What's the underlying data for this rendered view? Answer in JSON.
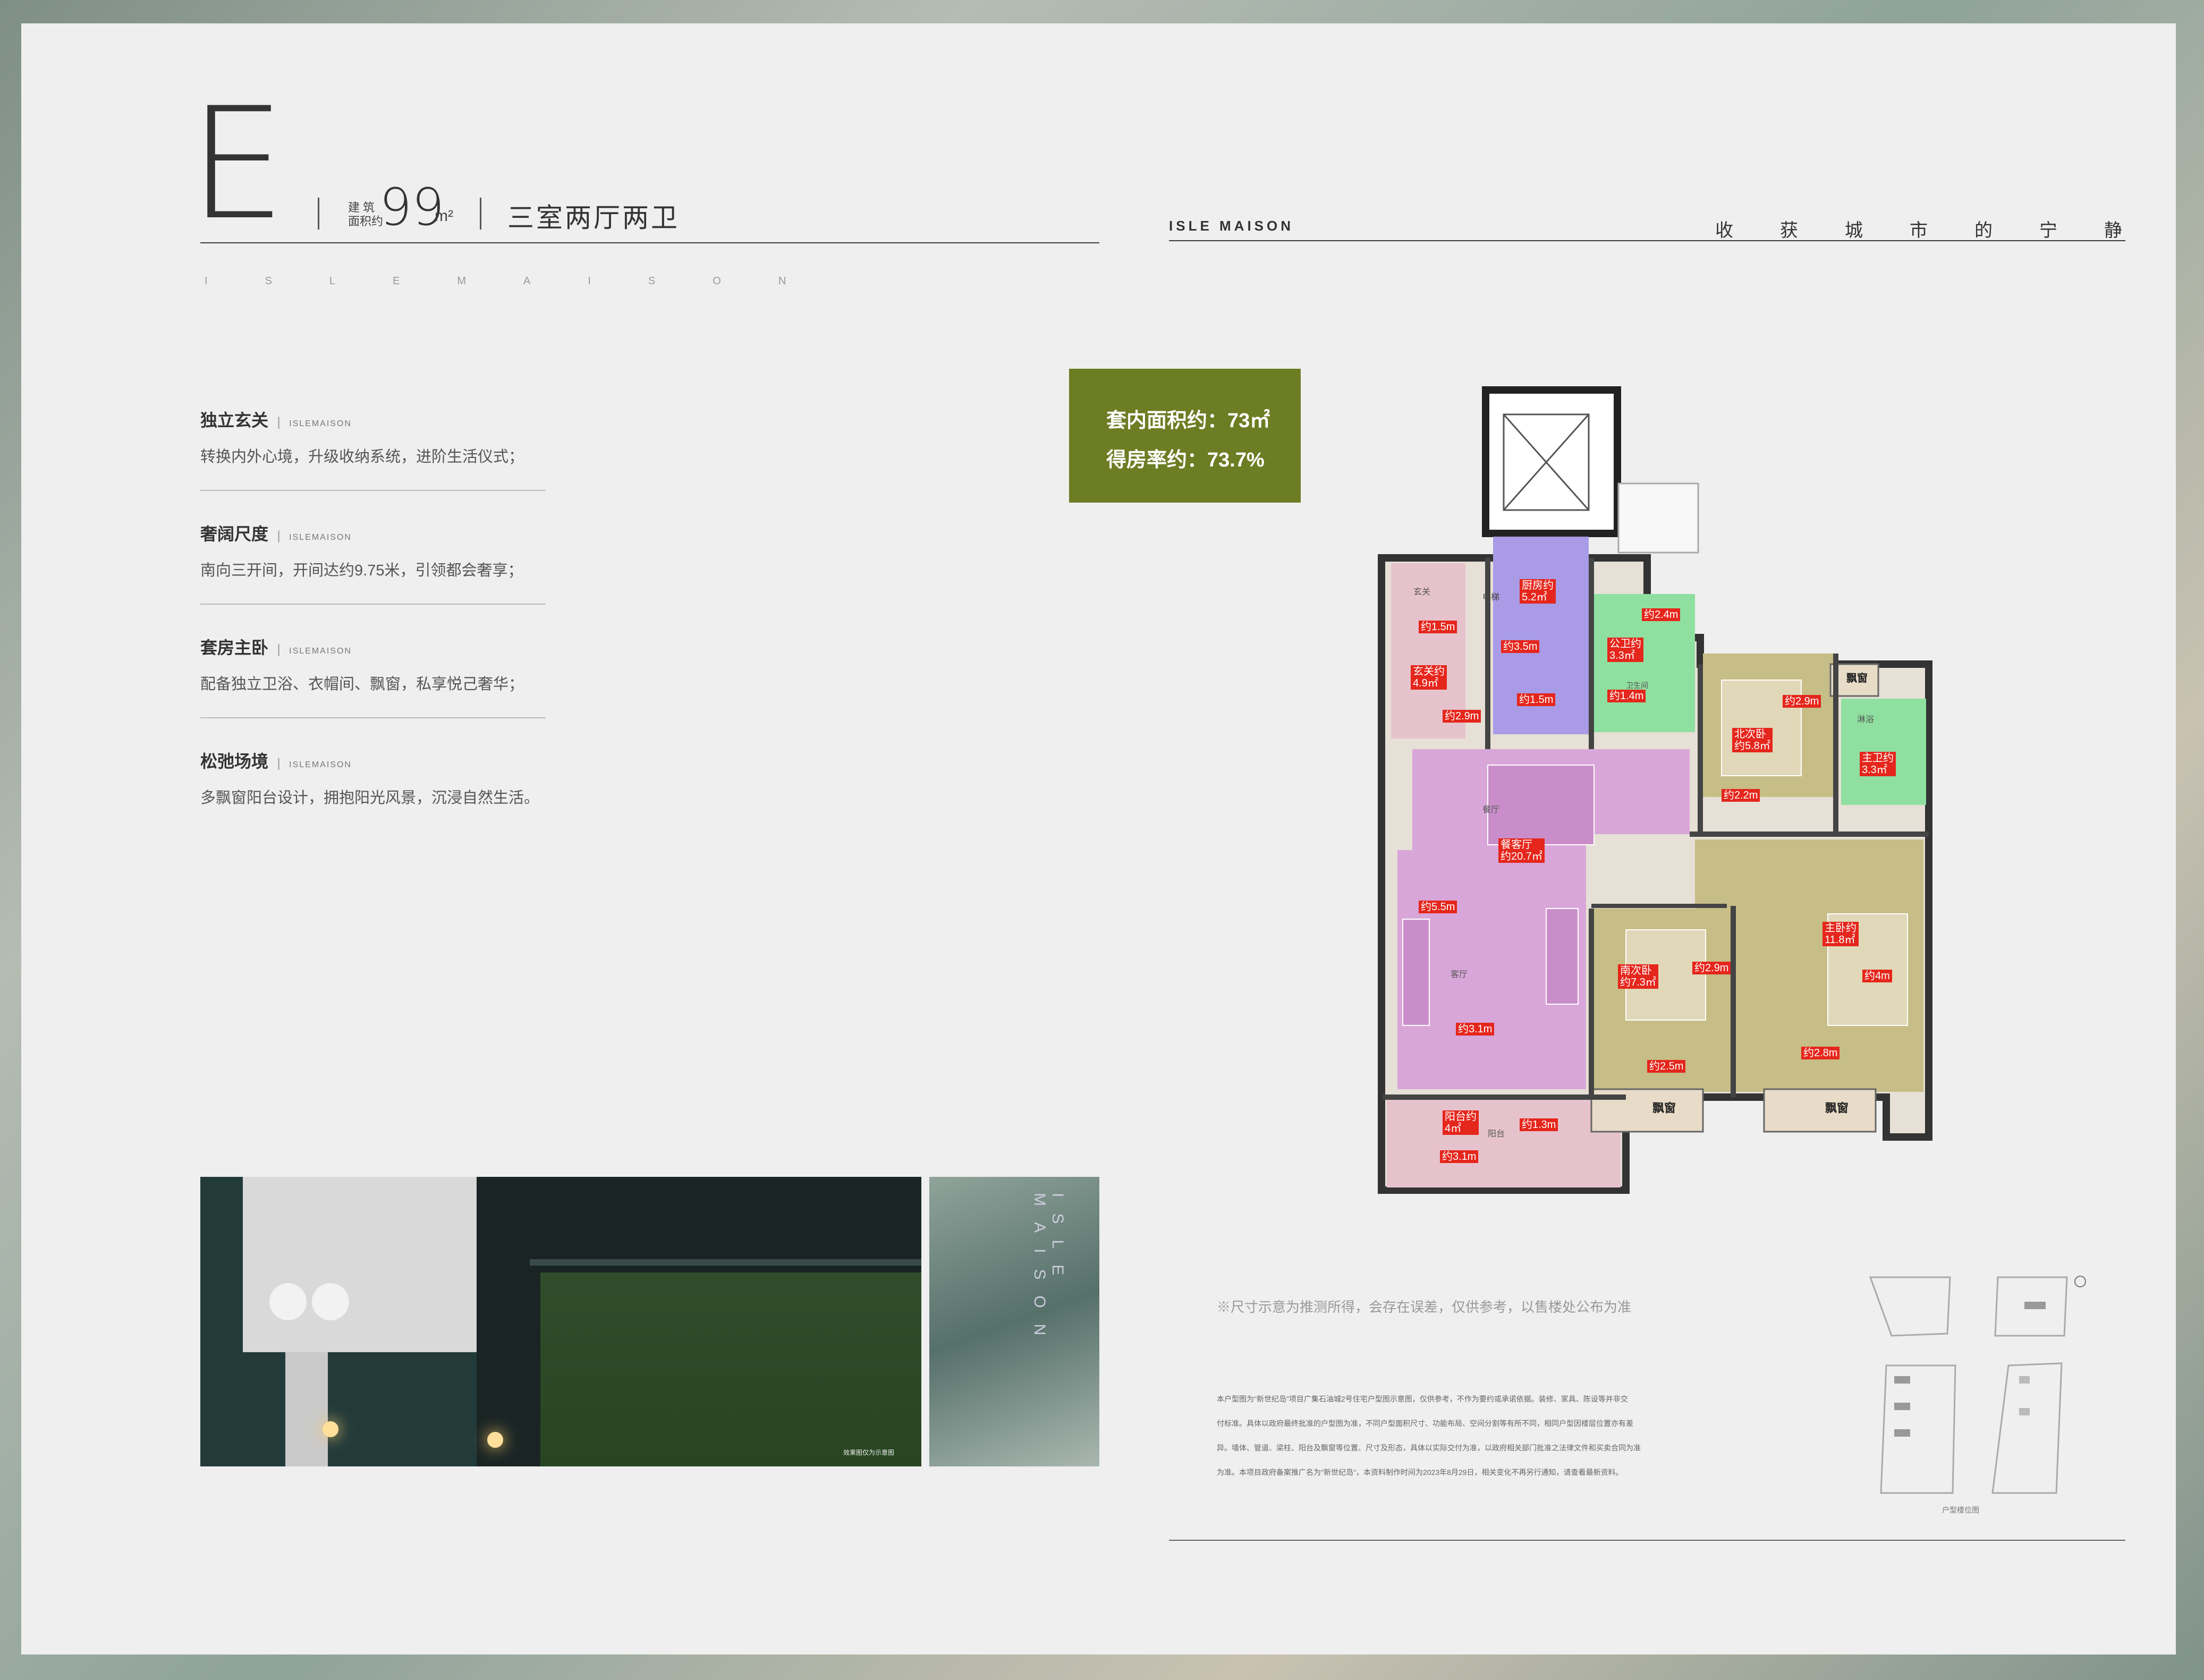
{
  "header": {
    "type_letter": "E",
    "area_label_line1": "建 筑",
    "area_label_line2": "面积约",
    "area_value": "99",
    "area_unit": "m²",
    "layout_title": "三室两厅两卫",
    "spaced_brand": "ISLEMAISON",
    "brand": "ISLE MAISON",
    "slogan": "收获城市的宁静"
  },
  "features": [
    {
      "title": "独立玄关",
      "sub": "ISLEMAISON",
      "desc": "转换内外心境，升级收纳系统，进阶生活仪式；"
    },
    {
      "title": "奢阔尺度",
      "sub": "ISLEMAISON",
      "desc": "南向三开间，开间达约9.75米，引领都会奢享；"
    },
    {
      "title": "套房主卧",
      "sub": "ISLEMAISON",
      "desc": "配备独立卫浴、衣帽间、飘窗，私享悦己奢华；"
    },
    {
      "title": "松弛场境",
      "sub": "ISLEMAISON",
      "desc": "多飘窗阳台设计，拥抱阳光风景，沉浸自然生活。"
    }
  ],
  "summary": {
    "inner_area": "套内面积约：73㎡",
    "usage_rate": "得房率约：73.7%"
  },
  "floorplan": {
    "colors": {
      "pink": "#d9a6d9",
      "purple": "#a99be6",
      "green": "#8fe0a0",
      "olive": "#c7bd86",
      "lightpink": "#e6c3cc",
      "tag": "#e5261c"
    },
    "rooms": [
      {
        "name": "玄关约\n4.9㎡"
      },
      {
        "name": "厨房约\n5.2㎡"
      },
      {
        "name": "公卫约\n3.3㎡"
      },
      {
        "name": "北次卧\n约5.8㎡"
      },
      {
        "name": "主卫约\n3.3㎡"
      },
      {
        "name": "餐客厅\n约20.7㎡"
      },
      {
        "name": "南次卧\n约7.3㎡"
      },
      {
        "name": "主卧约\n11.8㎡"
      },
      {
        "name": "阳台约\n4㎡"
      }
    ],
    "dims": [
      "约1.5m",
      "约3.5m",
      "约1.5m",
      "约2.4m",
      "约1.4m",
      "约2.9m",
      "约2.9m",
      "约2.2m",
      "约5.5m",
      "约3.1m",
      "约2.9m",
      "约4m",
      "约2.5m",
      "约2.8m",
      "约1.3m",
      "约3.1m"
    ],
    "labels": {
      "bay1": "飘窗",
      "bay2": "飘窗",
      "bay3": "飘窗",
      "elevator": "电梯",
      "entry": "玄关",
      "dining": "餐厅",
      "living": "客厅",
      "balcony": "阳台",
      "wash": "卫生间",
      "bath": "淋浴"
    }
  },
  "disclaimer": "※尺寸示意为推测所得，会存在误差，仅供参考，以售楼处公布为准",
  "fine_print": [
    "本户型图为\"新世纪岛\"项目广集石油城2号住宅户型图示意图，仅供参考，不作为要约或承诺依据。装修、家具、陈设等并非交",
    "付标准。具体以政府最终批准的户型图为准，不同户型面积尺寸、功能布局、空间分割等有所不同，相同户型因楼层位置亦有差",
    "异。墙体、管道、梁柱、阳台及飘窗等位置、尺寸及形态，具体以实际交付为准，以政府相关部门批准之法律文件和买卖合同为准",
    "为准。本项目政府备案推广名为\"新世纪岛\"，本资料制作时间为2023年8月29日，相关变化不再另行通知，请查看最新资料。"
  ],
  "keyplan_label": "户型楼位图",
  "photo": {
    "caption": "效果图仅为示意图",
    "side_text": "ISLE MAISON"
  }
}
